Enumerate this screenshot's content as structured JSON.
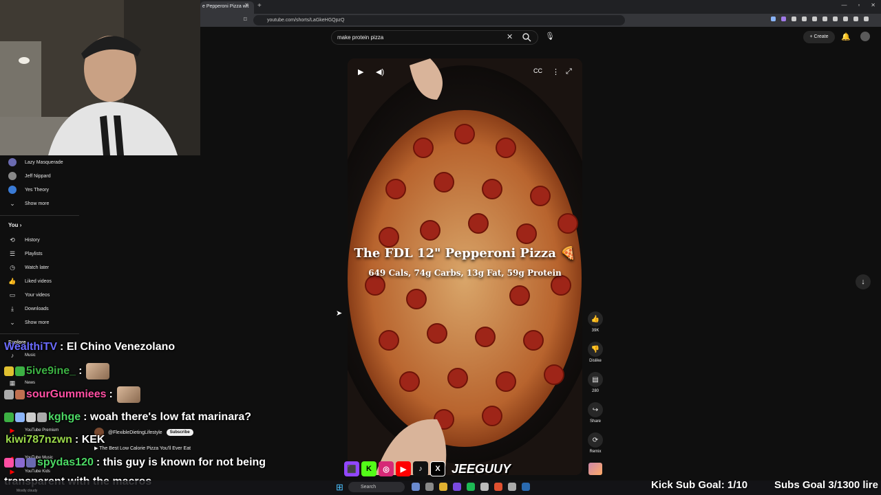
{
  "browser": {
    "tab_title": "e Pepperoni Pizza wit",
    "url": "youtube.com/shorts/LaGkeHGQpzQ"
  },
  "header": {
    "search_value": "make protein pizza",
    "create_label": "Create"
  },
  "sidebar": {
    "subscriptions": [
      {
        "label": "Lazy Masquerade",
        "color": "#6a6ab0"
      },
      {
        "label": "Jeff Nippard",
        "color": "#888888"
      },
      {
        "label": "Yes Theory",
        "color": "#3a7bd5"
      }
    ],
    "show_more_1": "Show more",
    "you_label": "You",
    "you_items": [
      {
        "label": "History",
        "icon": "history-icon",
        "glyph": "⟲"
      },
      {
        "label": "Playlists",
        "icon": "playlists-icon",
        "glyph": "☰"
      },
      {
        "label": "Watch later",
        "icon": "clock-icon",
        "glyph": "◷"
      },
      {
        "label": "Liked videos",
        "icon": "thumb-up-icon",
        "glyph": "👍"
      },
      {
        "label": "Your videos",
        "icon": "video-icon",
        "glyph": "▭"
      },
      {
        "label": "Downloads",
        "icon": "download-icon",
        "glyph": "⤓"
      }
    ],
    "show_more_2": "Show more",
    "explore_label": "Explore",
    "explore_items": [
      {
        "label": "Music",
        "top": 0
      },
      {
        "label": "News",
        "top": 0
      }
    ],
    "more_items": [
      "YouTube Premium",
      "YouTube Music",
      "YouTube Kids"
    ]
  },
  "short": {
    "title": "The FDL 12\" Pepperoni Pizza 🍕",
    "macros": "649 Cals, 74g Carbs, 13g Fat, 59g Protein",
    "channel": "@FlexibleDietingLifestyle",
    "subscribe_label": "Subscribe",
    "description": "▶ The Best Low Calorie Pizza You'll Ever Eat",
    "likes": "39K",
    "dislike_label": "Dislike",
    "comments": "280",
    "share_label": "Share",
    "remix_label": "Remix"
  },
  "chat": [
    {
      "user": "WealthiTV",
      "color": "#6b6bff",
      "message": ": El Chino Venezolano",
      "emote": false
    },
    {
      "user": "5ive9ine_",
      "color": "#3cb043",
      "message": ":",
      "emote": true
    },
    {
      "user": "sourGummiees",
      "color": "#ff4fa3",
      "message": ":",
      "emote": true
    },
    {
      "user": "kghge",
      "color": "#4cd964",
      "message": ": woah there's low fat marinara?",
      "emote": false
    },
    {
      "user": "kiwi787nzwn",
      "color": "#9ad84a",
      "message": ": KEK",
      "emote": false
    },
    {
      "user": "spydas120",
      "color": "#4cd964",
      "message": ": this guy is known for not being",
      "emote": false
    },
    {
      "user": "",
      "color": "#ffffff",
      "message": "transparent with the macros",
      "emote": false
    }
  ],
  "overlay": {
    "handle": "JEEGUUY",
    "kick_goal": "Kick Sub Goal: 1/10",
    "subs_goal": "Subs Goal 3/1300 lire"
  },
  "taskbar": {
    "search_label": "Search",
    "tray_text": "Mostly cloudy"
  }
}
